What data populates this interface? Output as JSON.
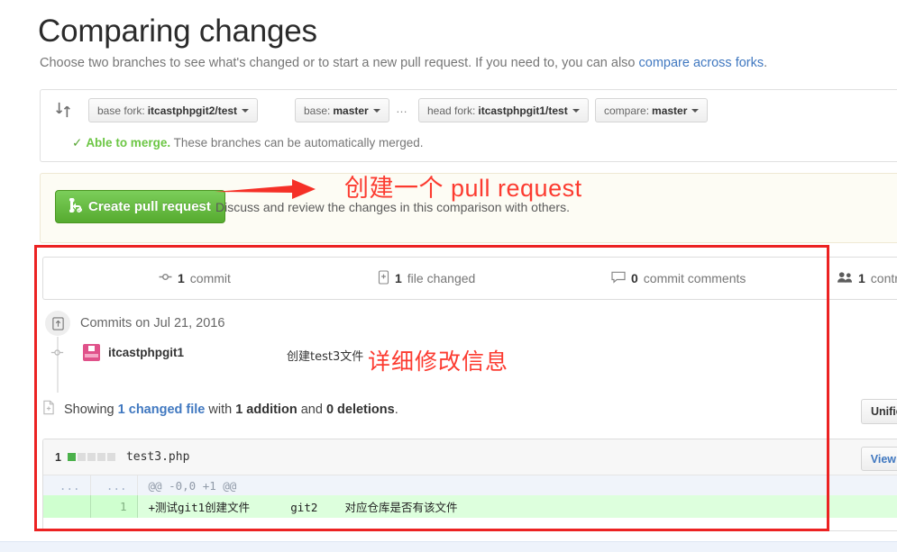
{
  "page": {
    "title": "Comparing changes",
    "subtitle_pre": "Choose two branches to see what's changed or to start a new pull request. If you need to, you can also ",
    "subtitle_link": "compare across forks",
    "subtitle_post": "."
  },
  "branch_bar": {
    "sync_icon": "compare-sync-icon",
    "selectors": [
      {
        "name": "base-fork",
        "label": "base fork:",
        "value": "itcastphpgit2/test"
      },
      {
        "name": "base",
        "label": "base:",
        "value": "master"
      },
      {
        "name": "head-fork",
        "label": "head fork:",
        "value": "itcastphpgit1/test"
      },
      {
        "name": "compare",
        "label": "compare:",
        "value": "master"
      }
    ],
    "separator": "…",
    "merge_check": "✓",
    "merge_status": "Able to merge.",
    "merge_detail": "These branches can be automatically merged."
  },
  "pr_banner": {
    "button_label": "Create pull request",
    "button_icon": "git-pull-request-icon",
    "description": "Discuss and review the changes in this comparison with others.",
    "button_color": "#56ab2f",
    "background_color": "#fdfcf4"
  },
  "annotations": {
    "color": "#fc3b30",
    "arrow": "red-arrow-right",
    "pr_text": "创建一个  pull request",
    "commit_text": "详细修改信息",
    "box_color": "#ec2222"
  },
  "comparison_tabs": [
    {
      "name": "commits",
      "icon": "git-commit-icon",
      "count": "1",
      "label": "commit"
    },
    {
      "name": "files",
      "icon": "diff-file-icon",
      "count": "1",
      "label": "file changed"
    },
    {
      "name": "comments",
      "icon": "comment-icon",
      "count": "0",
      "label": "commit comments"
    },
    {
      "name": "contributors",
      "icon": "contributors-icon",
      "count": "1",
      "label": "contributor"
    }
  ],
  "commits": {
    "group_icon": "repo-push-icon",
    "group_label": "Commits on Jul 21, 2016",
    "author": "itcastphpgit1",
    "message": "创建test3文件"
  },
  "diff_summary": {
    "icon": "diff-file-icon",
    "prefix": "Showing ",
    "changed_file": "1 changed file",
    "mid": " with ",
    "additions": "1 addition",
    "and": " and ",
    "deletions": "0 deletions",
    "suffix": ".",
    "unified_button": "Unified"
  },
  "file": {
    "count": "1",
    "diffstat": [
      "add",
      "neutral",
      "neutral",
      "neutral",
      "neutral"
    ],
    "name": "test3.php",
    "view_button": "View"
  },
  "diff_rows": [
    {
      "type": "hunk",
      "old_line": "...",
      "new_line": "...",
      "code": "@@ -0,0 +1 @@"
    },
    {
      "type": "addition",
      "old_line": "",
      "new_line": "1",
      "code": "+测试git1创建文件      git2    对应仓库是否有该文件"
    }
  ]
}
